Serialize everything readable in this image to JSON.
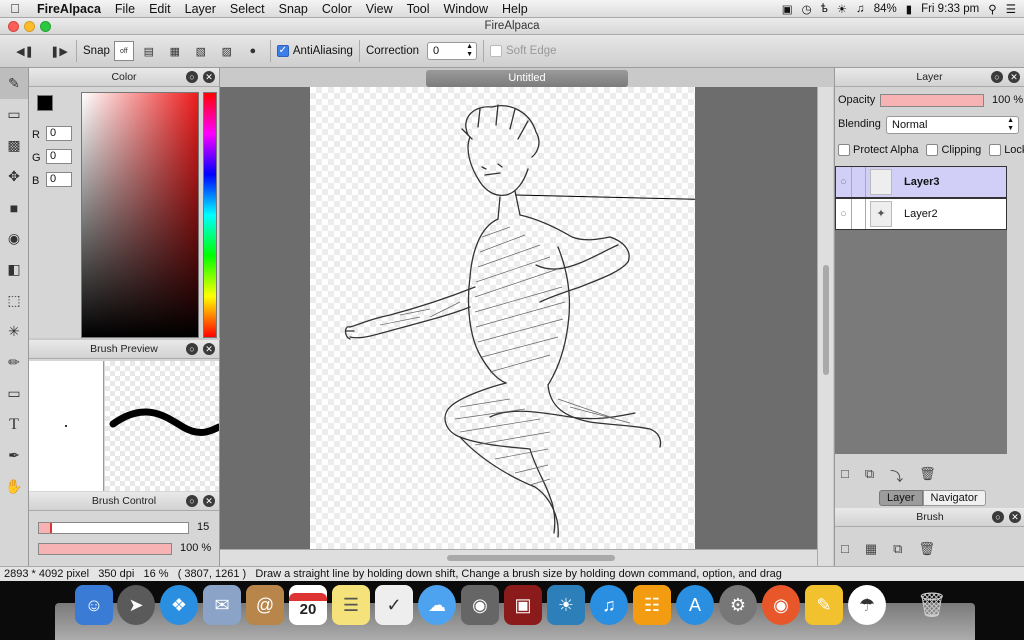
{
  "menubar": {
    "apple": "",
    "app": "FireAlpaca",
    "items": [
      "File",
      "Edit",
      "Layer",
      "Select",
      "Snap",
      "Color",
      "View",
      "Tool",
      "Window",
      "Help"
    ],
    "battery": "84%",
    "clock": "Fri 9:33 pm"
  },
  "window": {
    "title": "FireAlpaca"
  },
  "toolbar": {
    "snap_label": "Snap",
    "snap_off_label": "off",
    "antialiasing_label": "AntiAliasing",
    "antialiasing_checked": true,
    "correction_label": "Correction",
    "correction_value": "0",
    "soft_edge_label": "Soft Edge"
  },
  "color_panel": {
    "title": "Color",
    "r_label": "R",
    "r_value": "0",
    "g_label": "G",
    "g_value": "0",
    "b_label": "B",
    "b_value": "0",
    "primary_color": "#000000",
    "secondary_color": "#ffffff"
  },
  "brush_preview": {
    "title": "Brush Preview"
  },
  "brush_control": {
    "title": "Brush Control",
    "size_value": "15",
    "opacity_value": "100 %",
    "size_fraction": 0.09,
    "opacity_fraction": 1.0
  },
  "document": {
    "tab_title": "Untitled"
  },
  "layer_panel": {
    "title": "Layer",
    "opacity_label": "Opacity",
    "opacity_value": "100 %",
    "blending_label": "Blending",
    "blending_value": "Normal",
    "protect_alpha_label": "Protect Alpha",
    "clipping_label": "Clipping",
    "lock_label": "Lock",
    "layers": [
      {
        "name": "Layer3",
        "selected": true
      },
      {
        "name": "Layer2",
        "selected": false
      }
    ],
    "tabs": [
      "Layer",
      "Navigator"
    ],
    "active_tab": "Layer"
  },
  "brush_panel": {
    "title": "Brush"
  },
  "status": {
    "size": "2893 * 4092 pixel",
    "dpi": "350 dpi",
    "zoom": "16 %",
    "coords": "( 3807, 1261 )",
    "hint": "Draw a straight line by holding down shift, Change a brush size by holding down command, option, and drag"
  },
  "dock": {
    "calendar_day": "20"
  },
  "colors": {
    "selection": "#d1cff7",
    "slider_fill": "#f7b3b3",
    "accent": "#3d7ee8"
  }
}
